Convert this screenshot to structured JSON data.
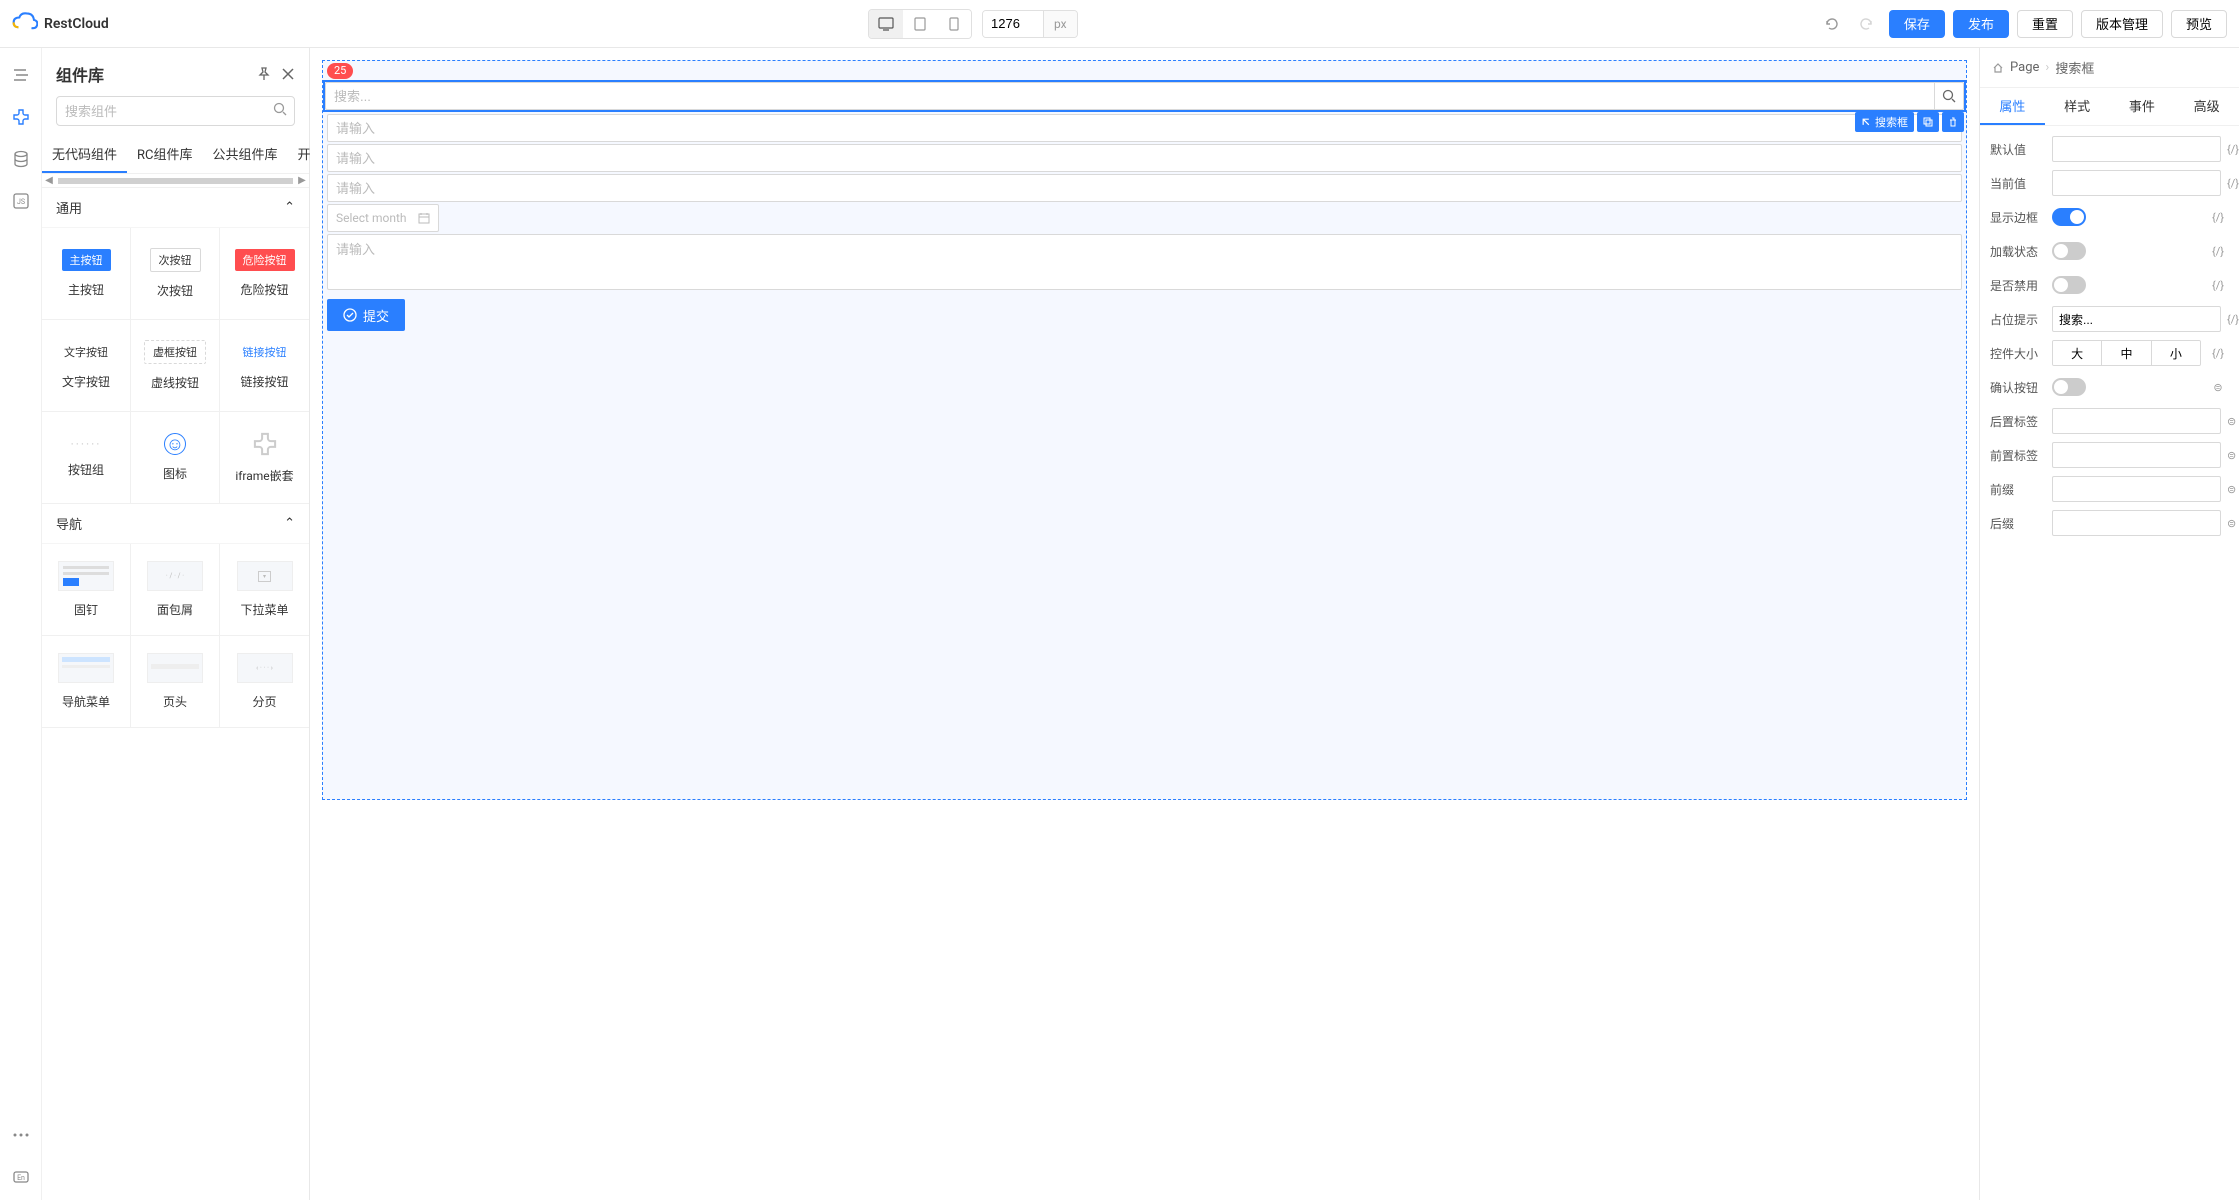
{
  "brand": "RestCloud",
  "topbar": {
    "width_value": "1276",
    "width_unit": "px",
    "save": "保存",
    "publish": "发布",
    "reset": "重置",
    "version": "版本管理",
    "preview": "预览"
  },
  "library": {
    "title": "组件库",
    "search_placeholder": "搜索组件",
    "tabs": [
      "无代码组件",
      "RC组件库",
      "公共组件库",
      "开发"
    ],
    "sections": {
      "general": {
        "title": "通用",
        "items": [
          {
            "preview": "主按钮",
            "label": "主按钮"
          },
          {
            "preview": "次按钮",
            "label": "次按钮"
          },
          {
            "preview": "危险按钮",
            "label": "危险按钮"
          },
          {
            "preview": "文字按钮",
            "label": "文字按钮"
          },
          {
            "preview": "虚框按钮",
            "label": "虚线按钮"
          },
          {
            "preview": "链接按钮",
            "label": "链接按钮"
          },
          {
            "preview": "······",
            "label": "按钮组"
          },
          {
            "preview": "☺",
            "label": "图标"
          },
          {
            "preview": "✦",
            "label": "iframe嵌套"
          }
        ]
      },
      "nav": {
        "title": "导航",
        "items": [
          {
            "label": "固钉"
          },
          {
            "label": "面包屑"
          },
          {
            "label": "下拉菜单"
          },
          {
            "label": "导航菜单"
          },
          {
            "label": "页头"
          },
          {
            "label": "分页"
          }
        ]
      }
    }
  },
  "canvas": {
    "badge": "25",
    "search_placeholder": "搜索...",
    "input_placeholder": "请输入",
    "month_placeholder": "Select month",
    "submit": "提交",
    "selected_label": "搜索框"
  },
  "props": {
    "breadcrumb_root": "Page",
    "breadcrumb_current": "搜索框",
    "tabs": [
      "属性",
      "样式",
      "事件",
      "高级"
    ],
    "rows": {
      "default_value": "默认值",
      "current_value": "当前值",
      "show_border": "显示边框",
      "loading": "加载状态",
      "disabled": "是否禁用",
      "placeholder": "占位提示",
      "placeholder_value": "搜索...",
      "size": "控件大小",
      "size_options": [
        "大",
        "中",
        "小"
      ],
      "confirm_btn": "确认按钮",
      "suffix_label": "后置标签",
      "prefix_label": "前置标签",
      "prefix": "前缀",
      "suffix": "后缀"
    },
    "bind_token": "{/}",
    "expr_token": "⊜"
  }
}
